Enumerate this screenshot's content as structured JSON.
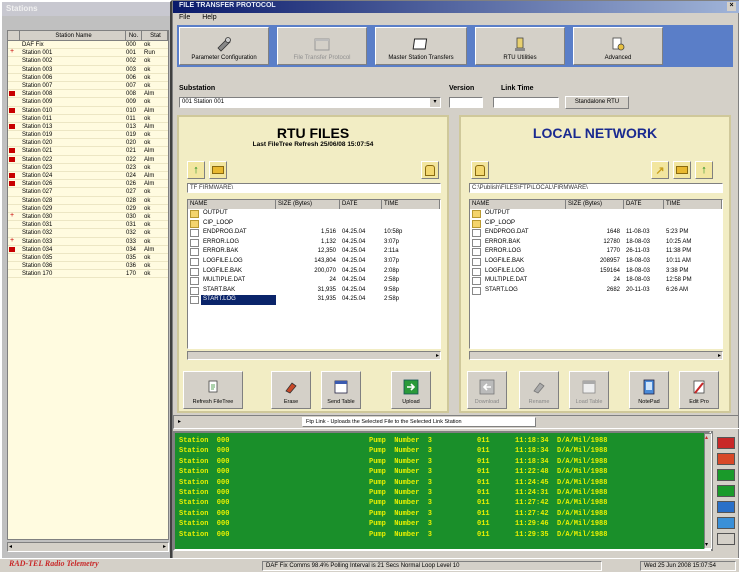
{
  "left_window": {
    "title": "Stations",
    "columns": [
      "",
      "Station Name",
      "No.",
      "Stat"
    ],
    "rows": [
      {
        "mark": "",
        "name": "DAF Fix",
        "no": "000",
        "stat": "ok"
      },
      {
        "mark": "plus",
        "name": "Station 001",
        "no": "001",
        "stat": "Run"
      },
      {
        "mark": "",
        "name": "Station 002",
        "no": "002",
        "stat": "ok"
      },
      {
        "mark": "",
        "name": "Station 003",
        "no": "003",
        "stat": "ok"
      },
      {
        "mark": "",
        "name": "Station 006",
        "no": "006",
        "stat": "ok"
      },
      {
        "mark": "",
        "name": "Station 007",
        "no": "007",
        "stat": "ok"
      },
      {
        "mark": "flag",
        "name": "Station 008",
        "no": "008",
        "stat": "Alm"
      },
      {
        "mark": "",
        "name": "Station 009",
        "no": "009",
        "stat": "ok"
      },
      {
        "mark": "flag",
        "name": "Station 010",
        "no": "010",
        "stat": "Alm"
      },
      {
        "mark": "",
        "name": "Station 011",
        "no": "011",
        "stat": "ok"
      },
      {
        "mark": "flag",
        "name": "Station 013",
        "no": "013",
        "stat": "Alm"
      },
      {
        "mark": "",
        "name": "Station 019",
        "no": "019",
        "stat": "ok"
      },
      {
        "mark": "",
        "name": "Station 020",
        "no": "020",
        "stat": "ok"
      },
      {
        "mark": "flag",
        "name": "Station 021",
        "no": "021",
        "stat": "Alm"
      },
      {
        "mark": "flag",
        "name": "Station 022",
        "no": "022",
        "stat": "Alm"
      },
      {
        "mark": "",
        "name": "Station 023",
        "no": "023",
        "stat": "ok"
      },
      {
        "mark": "flag",
        "name": "Station 024",
        "no": "024",
        "stat": "Alm"
      },
      {
        "mark": "flag",
        "name": "Station 026",
        "no": "026",
        "stat": "Alm"
      },
      {
        "mark": "",
        "name": "Station 027",
        "no": "027",
        "stat": "ok"
      },
      {
        "mark": "",
        "name": "Station 028",
        "no": "028",
        "stat": "ok"
      },
      {
        "mark": "",
        "name": "Station 029",
        "no": "029",
        "stat": "ok"
      },
      {
        "mark": "plus",
        "name": "Station 030",
        "no": "030",
        "stat": "ok"
      },
      {
        "mark": "",
        "name": "Station 031",
        "no": "031",
        "stat": "ok"
      },
      {
        "mark": "",
        "name": "Station 032",
        "no": "032",
        "stat": "ok"
      },
      {
        "mark": "plus",
        "name": "Station 033",
        "no": "033",
        "stat": "ok"
      },
      {
        "mark": "flag",
        "name": "Station 034",
        "no": "034",
        "stat": "Alm"
      },
      {
        "mark": "",
        "name": "Station 035",
        "no": "035",
        "stat": "ok"
      },
      {
        "mark": "",
        "name": "Station 036",
        "no": "036",
        "stat": "ok"
      },
      {
        "mark": "",
        "name": "Station 170",
        "no": "170",
        "stat": "ok"
      }
    ]
  },
  "main_window": {
    "title": "FILE TRANSFER PROTOCOL",
    "menu": [
      "File",
      "Help"
    ],
    "toolbar": [
      {
        "label": "Parameter Configuration",
        "selected": true,
        "icon": "tools-icon"
      },
      {
        "label": "File Transfer Protocol",
        "selected": false,
        "disabled": true,
        "icon": "window-icon"
      },
      {
        "label": "Master Station Transfers",
        "selected": true,
        "icon": "window-icon"
      },
      {
        "label": "RTU Utilities",
        "selected": true,
        "icon": "utility-icon"
      },
      {
        "label": "Advanced",
        "selected": true,
        "icon": "advanced-icon"
      }
    ],
    "substation_label": "Substation",
    "substation_value": "001 Station 001",
    "version_label": "Version",
    "link_time_label": "Link Time",
    "link_time_value": "",
    "standalone_btn": "Standalone RTU",
    "rtu": {
      "title": "RTU FILES",
      "subtitle": "Last FileTree Refresh 25/06/08 15:07:54",
      "path": "TF FIRMWARE\\",
      "columns": [
        "NAME",
        "SIZE (Bytes)",
        "DATE",
        "TIME"
      ],
      "files": [
        {
          "dir": true,
          "name": "OUTPUT",
          "size": "",
          "date": "",
          "time": ""
        },
        {
          "dir": true,
          "name": "CIP_LOOP",
          "size": "",
          "date": "",
          "time": ""
        },
        {
          "dir": false,
          "name": "ENDPROG.DAT",
          "size": "1,516",
          "date": "04.25.04",
          "time": "10:58p"
        },
        {
          "dir": false,
          "name": "ERROR.LOG",
          "size": "1,132",
          "date": "04.25.04",
          "time": "3:07p"
        },
        {
          "dir": false,
          "name": "ERROR.BAK",
          "size": "12,350",
          "date": "04.25.04",
          "time": "2:11a"
        },
        {
          "dir": false,
          "name": "LOGFILE.LOG",
          "size": "143,804",
          "date": "04.25.04",
          "time": "3:07p"
        },
        {
          "dir": false,
          "name": "LOGFILE.BAK",
          "size": "200,070",
          "date": "04.25.04",
          "time": "2:08p"
        },
        {
          "dir": false,
          "name": "MULTIPLE.DAT",
          "size": "24",
          "date": "04.25.04",
          "time": "2:58p"
        },
        {
          "dir": false,
          "name": "START.BAK",
          "size": "31,935",
          "date": "04.25.04",
          "time": "9:58p"
        },
        {
          "dir": false,
          "name": "START.LOG",
          "size": "31,935",
          "date": "04.25.04",
          "time": "2:58p",
          "selected": true
        }
      ],
      "buttons": [
        {
          "label": "Refresh FileTree",
          "icon": "refresh-icon"
        },
        {
          "label": "Erase",
          "icon": "erase-icon"
        },
        {
          "label": "Send Table",
          "icon": "send-table-icon"
        },
        {
          "label": "Upload",
          "icon": "upload-icon"
        }
      ]
    },
    "local": {
      "title": "LOCAL NETWORK",
      "path": "C:\\Publish\\FILES\\FTP\\LOCAL\\FIRMWARE\\",
      "columns": [
        "NAME",
        "SIZE (Bytes)",
        "DATE",
        "TIME"
      ],
      "files": [
        {
          "dir": true,
          "name": "OUTPUT",
          "size": "",
          "date": "",
          "time": ""
        },
        {
          "dir": true,
          "name": "CIP_LOOP",
          "size": "",
          "date": "",
          "time": ""
        },
        {
          "dir": false,
          "name": "ENDPROG.DAT",
          "size": "1648",
          "date": "11-08-03",
          "time": "5:23 PM"
        },
        {
          "dir": false,
          "name": "ERROR.BAK",
          "size": "12780",
          "date": "18-08-03",
          "time": "10:25 AM"
        },
        {
          "dir": false,
          "name": "ERROR.LOG",
          "size": "1770",
          "date": "26-11-03",
          "time": "11:38 PM"
        },
        {
          "dir": false,
          "name": "LOGFILE.BAK",
          "size": "208957",
          "date": "18-08-03",
          "time": "10:11 AM"
        },
        {
          "dir": false,
          "name": "LOGFILE.LOG",
          "size": "159164",
          "date": "18-08-03",
          "time": "3:38 PM"
        },
        {
          "dir": false,
          "name": "MULTIPLE.DAT",
          "size": "24",
          "date": "18-08-03",
          "time": "12:58 PM"
        },
        {
          "dir": false,
          "name": "START.LOG",
          "size": "2682",
          "date": "20-11-03",
          "time": "6:26 AM"
        }
      ],
      "buttons": [
        {
          "label": "Download",
          "icon": "download-icon",
          "disabled": true
        },
        {
          "label": "Rename",
          "icon": "rename-icon",
          "disabled": true
        },
        {
          "label": "Load Table",
          "icon": "load-table-icon",
          "disabled": true
        },
        {
          "label": "NotePad",
          "icon": "notepad-icon"
        },
        {
          "label": "Edit Pro",
          "icon": "edit-pro-icon"
        }
      ]
    },
    "hint": "Ftp Link - Uploads the Selected File to the Selected Link Station"
  },
  "log": [
    [
      "Station  000",
      "Pump  Number  3",
      "011",
      "11:18:34  D/A/Mil/1988"
    ],
    [
      "Station  000",
      "Pump  Number  3",
      "011",
      "11:18:34  D/A/Mil/1988"
    ],
    [
      "Station  000",
      "Pump  Number  3",
      "011",
      "11:18:34  D/A/Mil/1988"
    ],
    [
      "Station  000",
      "Pump  Number  3",
      "011",
      "11:22:48  D/A/Mil/1988"
    ],
    [
      "Station  000",
      "Pump  Number  3",
      "011",
      "11:24:45  D/A/Mil/1988"
    ],
    [
      "Station  000",
      "Pump  Number  3",
      "011",
      "11:24:31  D/A/Mil/1988"
    ],
    [
      "Station  000",
      "Pump  Number  3",
      "011",
      "11:27:42  D/A/Mil/1988"
    ],
    [
      "Station  000",
      "Pump  Number  3",
      "011",
      "11:27:42  D/A/Mil/1988"
    ],
    [
      "Station  000",
      "Pump  Number  3",
      "011",
      "11:29:46  D/A/Mil/1988"
    ],
    [
      "Station  000",
      "Pump  Number  3",
      "011",
      "11:29:35  D/A/Mil/1988"
    ]
  ],
  "side_buttons": [
    "#c82828",
    "#d84828",
    "#1a9a2a",
    "#1a9a2a",
    "#2a70c8",
    "#3a90d8",
    "#d4d0c8"
  ],
  "bottom": {
    "logo": "RAD-TEL  Radio Telemetry",
    "seg1": "DAF Fix   Comms 98.4%   Polling Interval is 21 Secs   Normal Loop   Level 10",
    "seg2": "Wed 25 Jun 2008  15:07:54"
  }
}
